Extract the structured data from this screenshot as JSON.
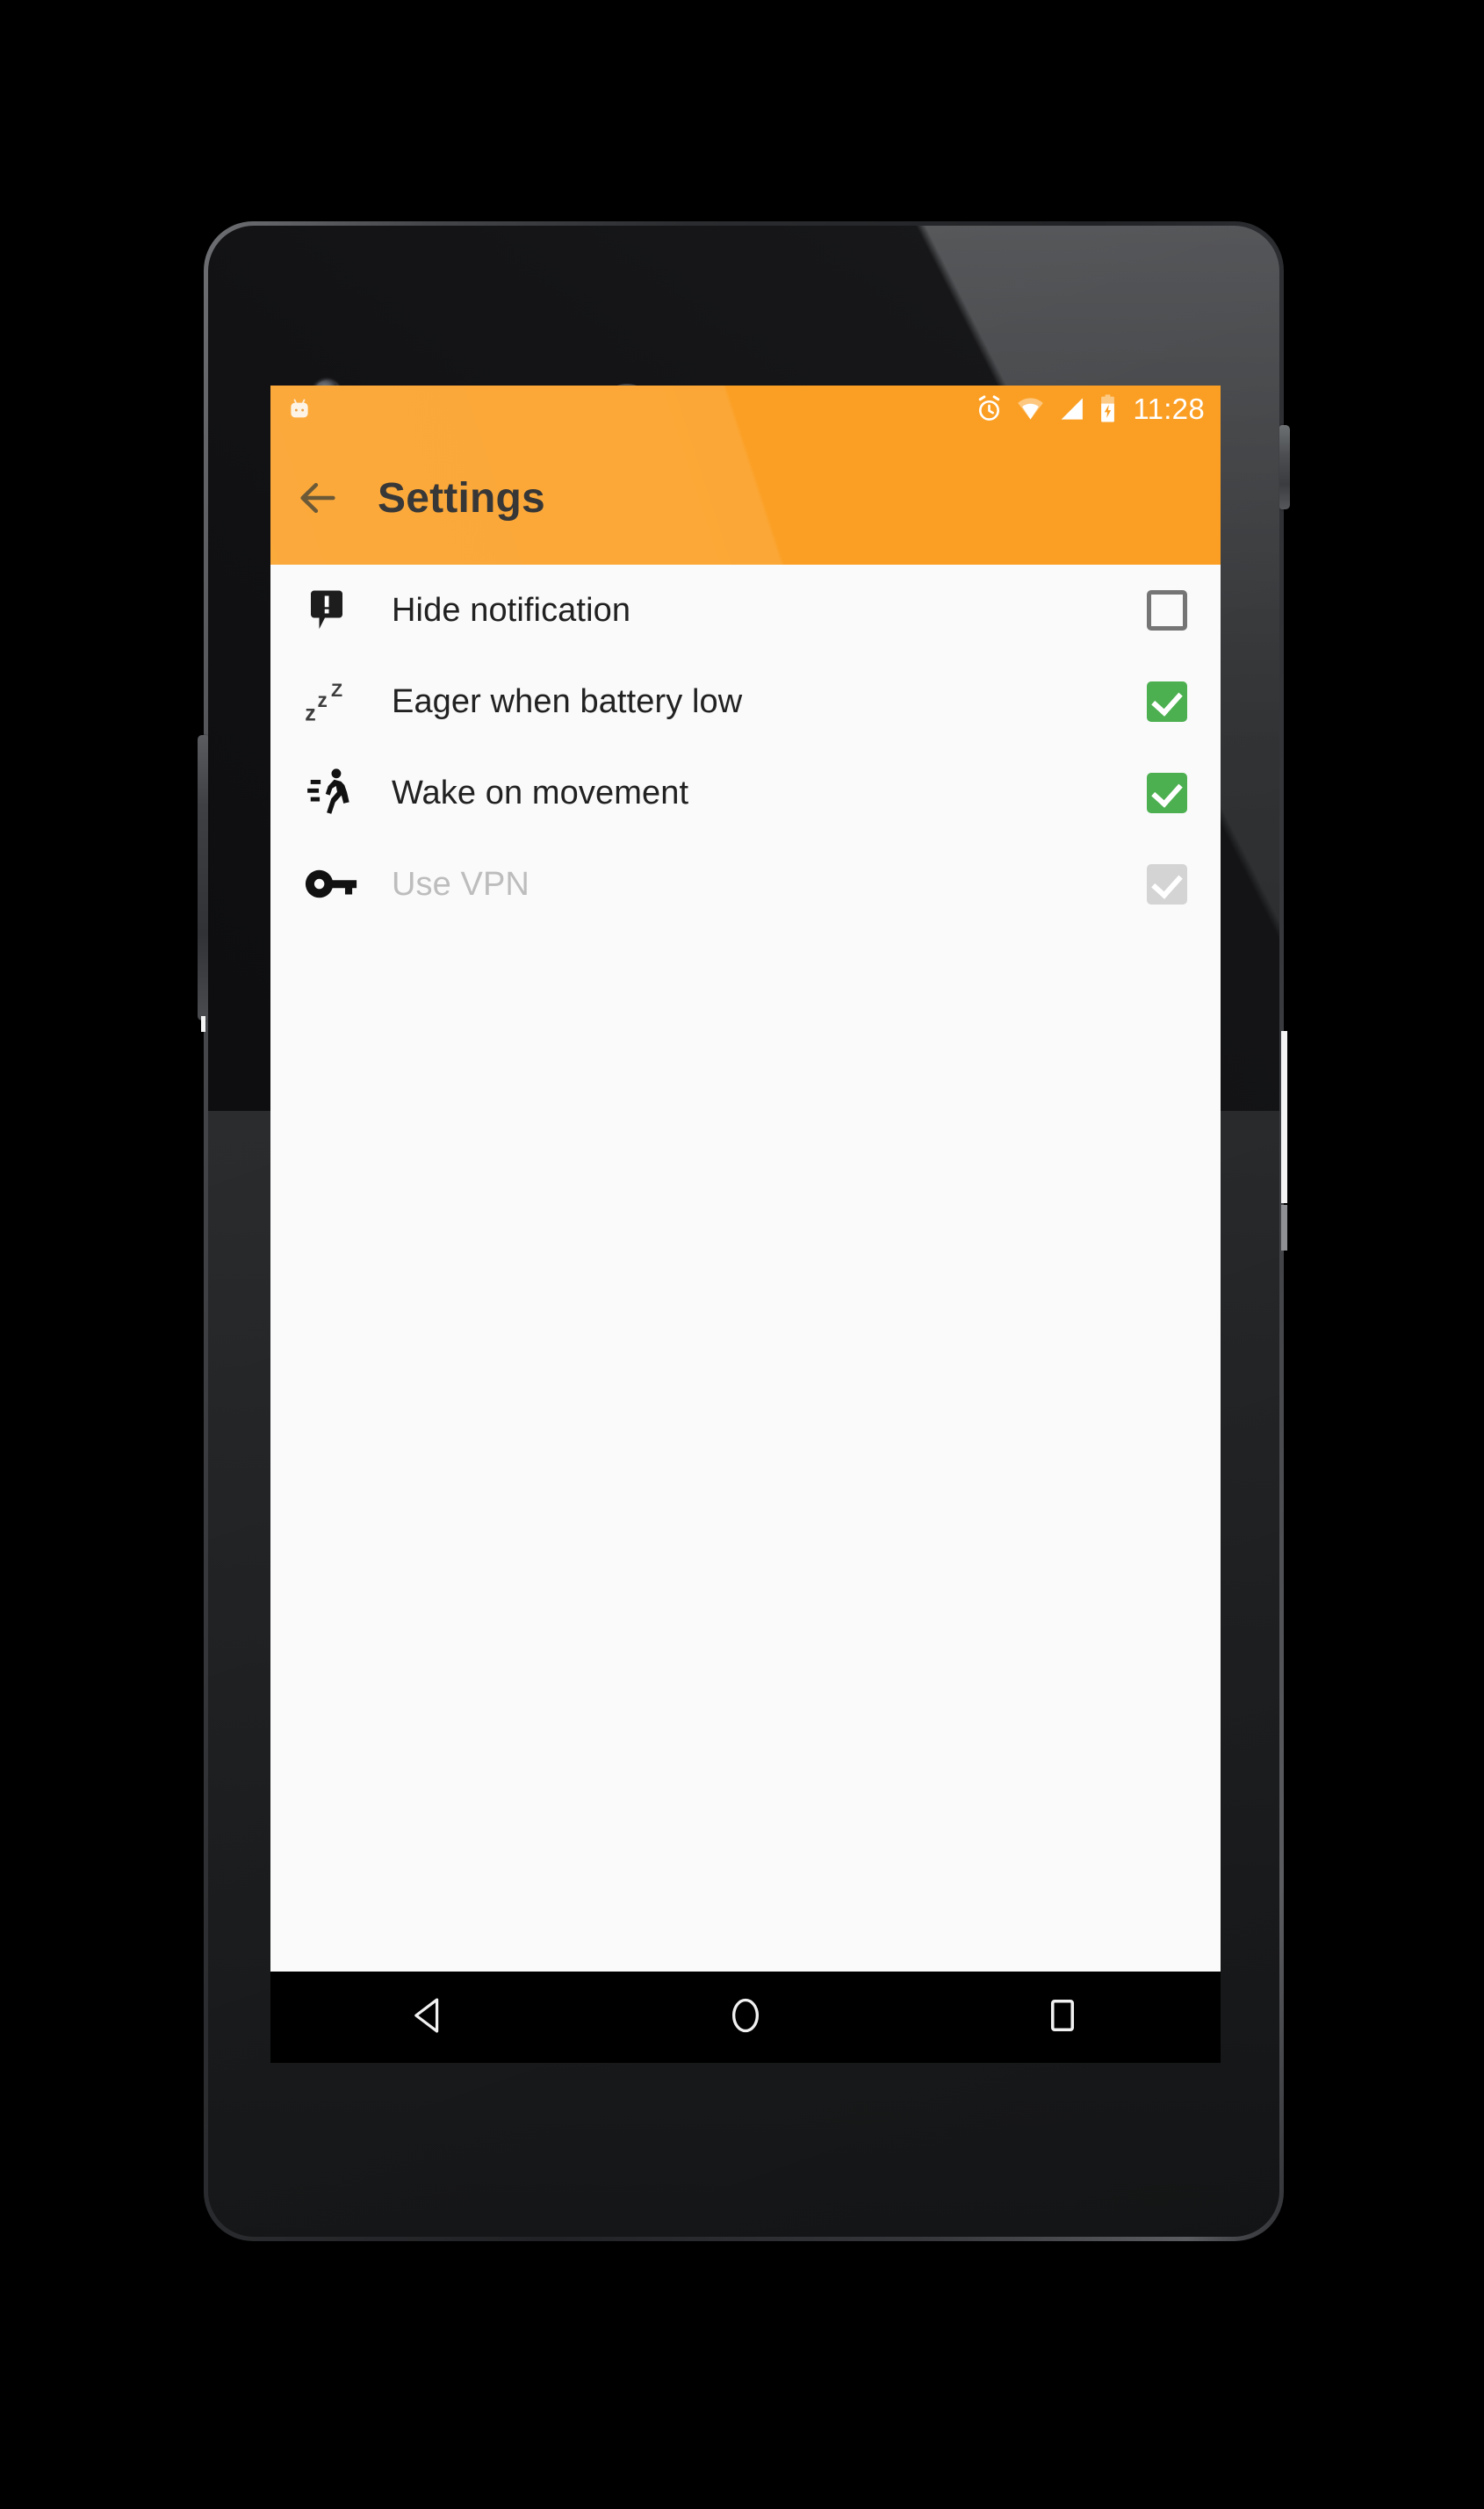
{
  "device": {
    "name": "android-phone",
    "frame_color": "#2a2c2f",
    "screen_bg": "#fafafa"
  },
  "statusbar": {
    "time": "11:28",
    "brand_icon": "android-marshmallow-icon",
    "icons": [
      "alarm-icon",
      "wifi-icon",
      "cell-signal-icon",
      "battery-charging-icon"
    ],
    "background": "#fb9f24",
    "foreground": "#ffffff"
  },
  "toolbar": {
    "title": "Settings",
    "back_icon": "back-arrow-icon",
    "background": "#fb9f24",
    "title_color": "#212121"
  },
  "settings": {
    "rows": [
      {
        "label": "Hide notification",
        "icon": "notification-alert-icon",
        "checked": false,
        "enabled": true
      },
      {
        "label": "Eager when battery low",
        "icon": "sleep-zzz-icon",
        "checked": true,
        "enabled": true
      },
      {
        "label": "Wake on movement",
        "icon": "running-person-icon",
        "checked": true,
        "enabled": true
      },
      {
        "label": "Use VPN",
        "icon": "key-icon",
        "checked": true,
        "enabled": false
      }
    ],
    "checkbox_on_color": "#4caf50",
    "checkbox_off_color": "#757575",
    "checkbox_disabled_color": "#d4d4d4",
    "disabled_text_color": "#bdbdbd"
  },
  "navbar": {
    "background": "#000000",
    "buttons": [
      {
        "name": "back-nav-button",
        "icon": "triangle-back-icon"
      },
      {
        "name": "home-nav-button",
        "icon": "circle-home-icon"
      },
      {
        "name": "recents-nav-button",
        "icon": "square-recents-icon"
      }
    ]
  },
  "hardware": {
    "front_camera": "front-camera-lens",
    "earpiece": "earpiece-speaker",
    "power_button": "power-button",
    "volume_button": "volume-rocker-button"
  }
}
